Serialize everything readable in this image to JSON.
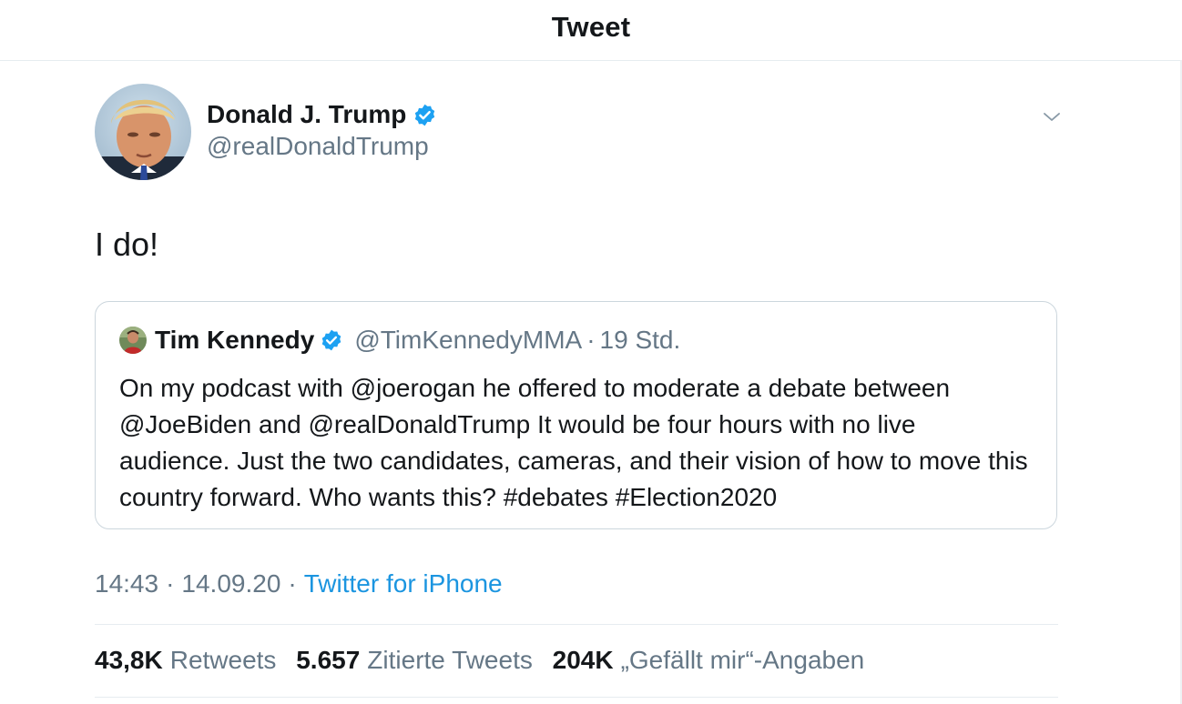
{
  "header": {
    "title": "Tweet"
  },
  "tweet": {
    "author": {
      "name": "Donald J. Trump",
      "handle": "@realDonaldTrump",
      "verified": true
    },
    "text": "I do!",
    "time": "14:43",
    "date": "14.09.20",
    "source": "Twitter for iPhone",
    "separator": "·"
  },
  "quoted_tweet": {
    "author": {
      "name": "Tim Kennedy",
      "handle": "@TimKennedyMMA",
      "verified": true
    },
    "separator": "·",
    "age": "19 Std.",
    "text": "On my podcast with @joerogan he offered to moderate a debate between @JoeBiden and @realDonaldTrump It would be four hours with no live audience. Just the two candidates, cameras, and their vision of how to move this country forward. Who wants this? #debates #Election2020"
  },
  "stats": [
    {
      "value": "43,8K",
      "label": "Retweets"
    },
    {
      "value": "5.657",
      "label": "Zitierte Tweets"
    },
    {
      "value": "204K",
      "label": "„Gefällt mir“-Angaben"
    }
  ],
  "icons": {
    "verified": "verified-badge-icon",
    "more": "chevron-down-icon"
  },
  "colors": {
    "text": "#14171a",
    "secondary": "#657786",
    "accent": "#1b95e0",
    "verified": "#1da1f2",
    "border": "#ccd6dd"
  }
}
